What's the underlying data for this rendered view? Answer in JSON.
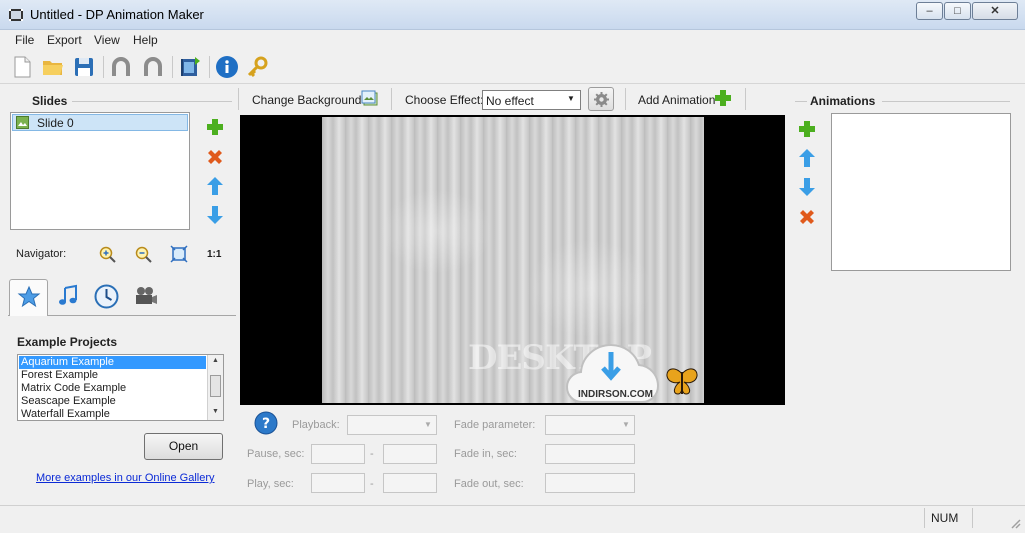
{
  "window": {
    "title": "Untitled - DP Animation Maker",
    "minimize_glyph": "–",
    "maximize_glyph": "□",
    "close_glyph": "✕"
  },
  "menu": [
    "File",
    "Export",
    "View",
    "Help"
  ],
  "toolbar": {
    "icons": [
      "new-file-icon",
      "open-folder-icon",
      "save-icon",
      "undo-icon",
      "redo-icon",
      "export-video-icon",
      "info-icon",
      "key-icon"
    ]
  },
  "slides": {
    "title": "Slides",
    "items": [
      {
        "label": "Slide 0",
        "selected": true
      }
    ],
    "actions": [
      "add-icon",
      "delete-icon",
      "move-up-icon",
      "move-down-icon"
    ]
  },
  "navigator": {
    "label": "Navigator:",
    "one_to_one": "1:1"
  },
  "tabs": [
    "star-icon",
    "music-icon",
    "clock-icon",
    "camera-icon"
  ],
  "examples": {
    "title": "Example Projects",
    "items": [
      "Aquarium Example",
      "Forest Example",
      "Matrix Code Example",
      "Seascape Example",
      "Waterfall Example"
    ],
    "selected_index": 0,
    "open_label": "Open",
    "gallery_link": "More examples in our Online Gallery"
  },
  "stage_toolbar": {
    "change_background": "Change Background",
    "choose_effect_label": "Choose Effect:",
    "effect_value": "No effect",
    "add_animation": "Add Animation"
  },
  "watermark": {
    "text1": "DESKTOP",
    "text2": "INDIRSON.COM"
  },
  "params": {
    "playback": "Playback:",
    "pause": "Pause, sec:",
    "play": "Play, sec:",
    "fade_parameter": "Fade parameter:",
    "fade_in": "Fade in, sec:",
    "fade_out": "Fade out, sec:",
    "dash": "-"
  },
  "animations": {
    "title": "Animations",
    "actions": [
      "add-icon",
      "move-up-icon",
      "move-down-icon",
      "delete-icon"
    ]
  },
  "status": {
    "num": "NUM"
  },
  "colors": {
    "add_green": "#4caf1f",
    "delete_orange": "#e05a1c",
    "arrow_blue": "#3a9ee6",
    "selection": "#cde4f7"
  }
}
